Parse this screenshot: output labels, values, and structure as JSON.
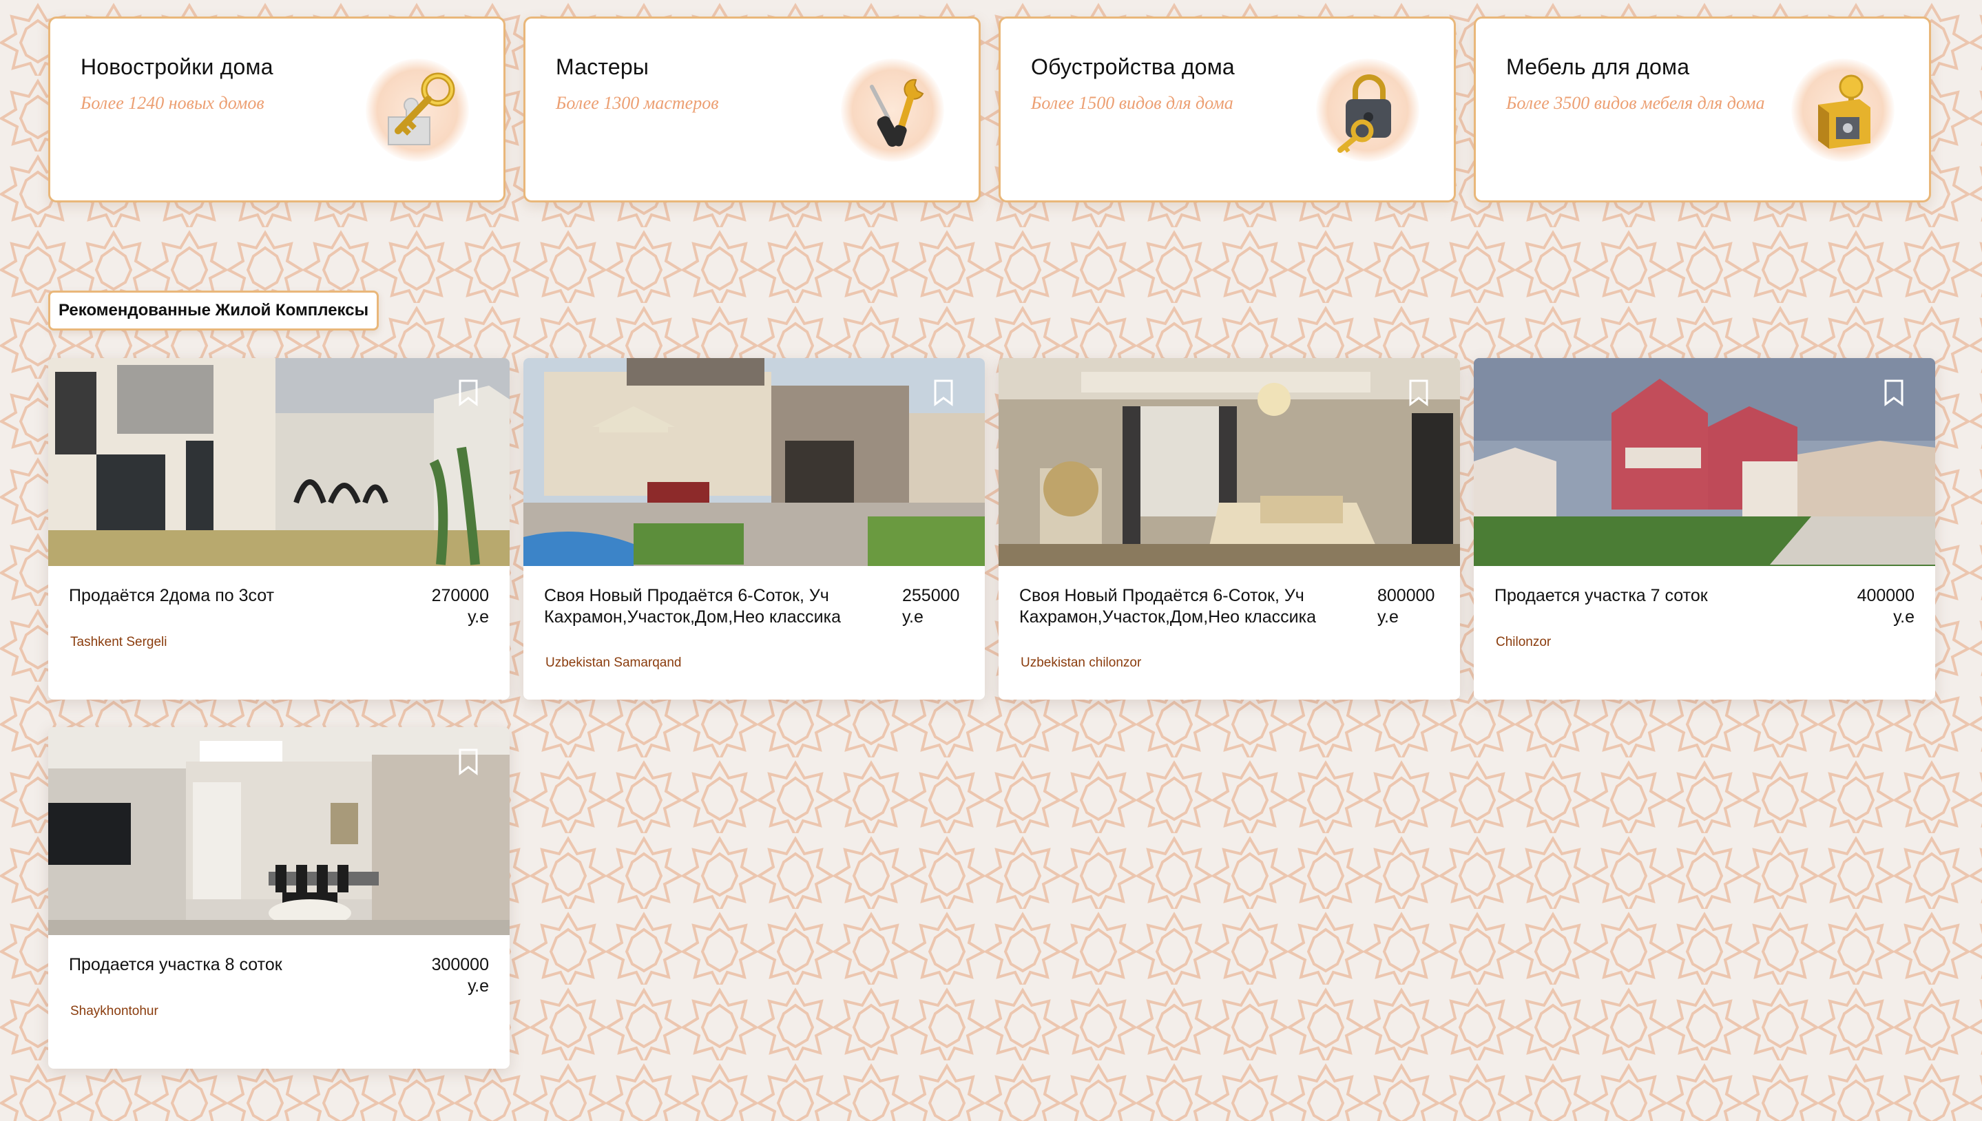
{
  "categories": [
    {
      "title": "Новостройки дома",
      "subtitle": "Более 1240 новых домов",
      "icon": "key-puzzle-icon"
    },
    {
      "title": "Мастеры",
      "subtitle": "Более 1300 мастеров",
      "icon": "tools-icon"
    },
    {
      "title": "Обустройства дома",
      "subtitle": "Более 1500 видов для дома",
      "icon": "padlock-key-icon"
    },
    {
      "title": "Мебель для дома",
      "subtitle": "Более 3500 видов мебеля для дома",
      "icon": "safe-key-icon"
    }
  ],
  "section": {
    "label": "Рекомендованные Жилой Комплексы"
  },
  "listings": [
    {
      "title": "Продаётся 2дома по 3сот",
      "price": "270000 у.е",
      "location": "Tashkent Sergeli"
    },
    {
      "title": "Своя Новый Продаётся 6-Соток, Уч Кахрамон,Участок,Дом,Нео классика",
      "price": "255000 у.е",
      "location": "Uzbekistan Samarqand"
    },
    {
      "title": "Своя Новый Продаётся 6-Соток, Уч Кахрамон,Участок,Дом,Нео классика",
      "price": "800000 у.е",
      "location": "Uzbekistan chilonzor"
    },
    {
      "title": "Продается участка 7 соток",
      "price": "400000 у.е",
      "location": "Chilonzor"
    },
    {
      "title": "Продается участка 8 соток",
      "price": "300000 у.е",
      "location": "Shaykhontohur"
    }
  ],
  "colors": {
    "accent_border": "#e9b77a",
    "subtitle_text": "#ec9f72",
    "location_text": "#8a3c0d",
    "pattern_stroke": "#e8b79a",
    "background": "#f3eeea"
  }
}
